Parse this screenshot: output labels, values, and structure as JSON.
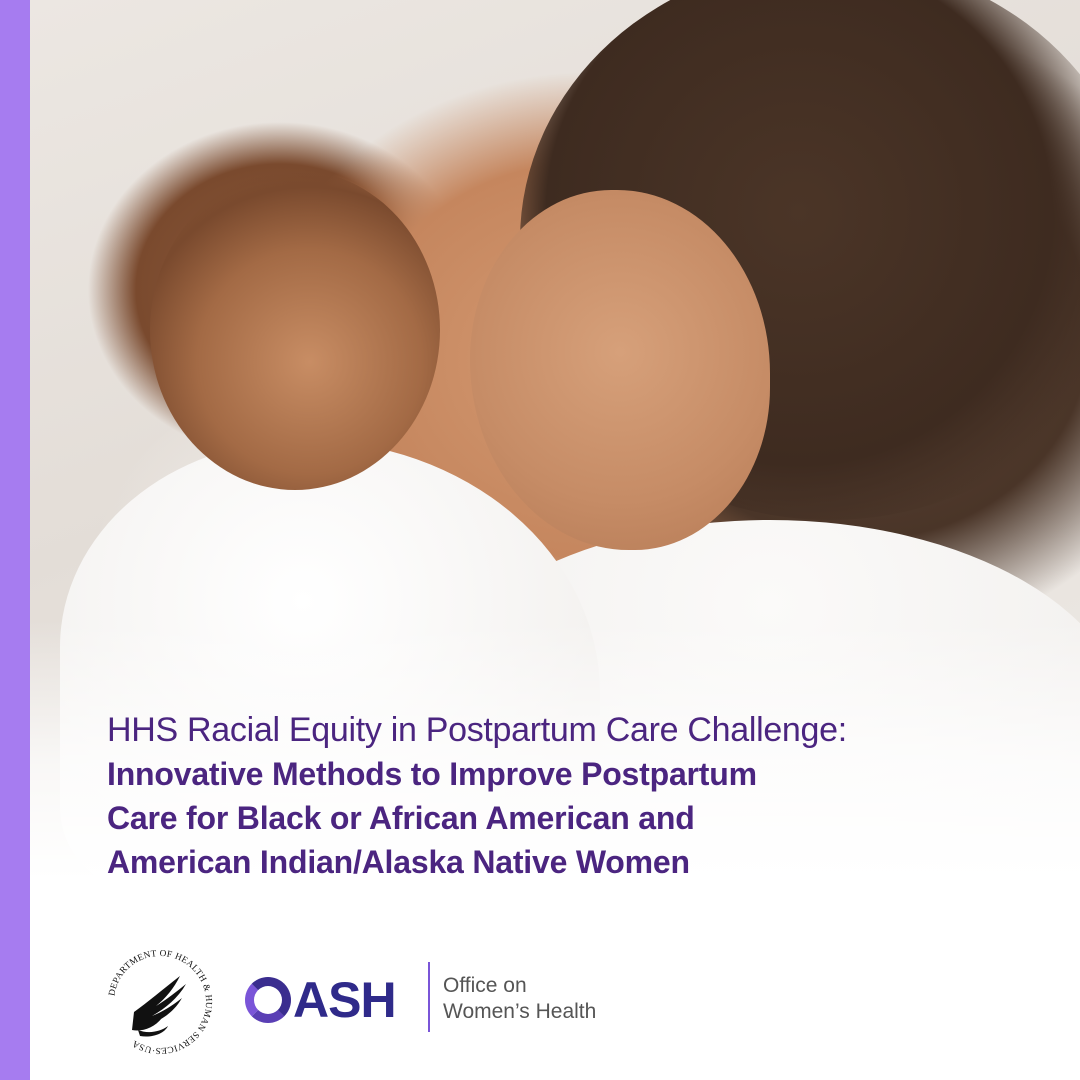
{
  "colors": {
    "accent_bar": "#a67cf0",
    "headline": "#4b2580",
    "oash_text": "#2f2a8a",
    "oash_ring": "#3a2d8f",
    "divider": "#7a55d8",
    "owh_text": "#555555"
  },
  "photo": {
    "subject": "mother-and-baby-photo"
  },
  "headline": {
    "line1": "HHS Racial Equity in Postpartum Care Challenge:",
    "line2": "Innovative Methods to Improve Postpartum",
    "line3": "Care for Black or African American and",
    "line4": "American Indian/Alaska Native Women"
  },
  "logos": {
    "hhs_seal_text": "DEPARTMENT OF HEALTH & HUMAN SERVICES·USA",
    "oash_rest": "ASH",
    "owh_line1": "Office on",
    "owh_line2": "Women’s Health"
  }
}
